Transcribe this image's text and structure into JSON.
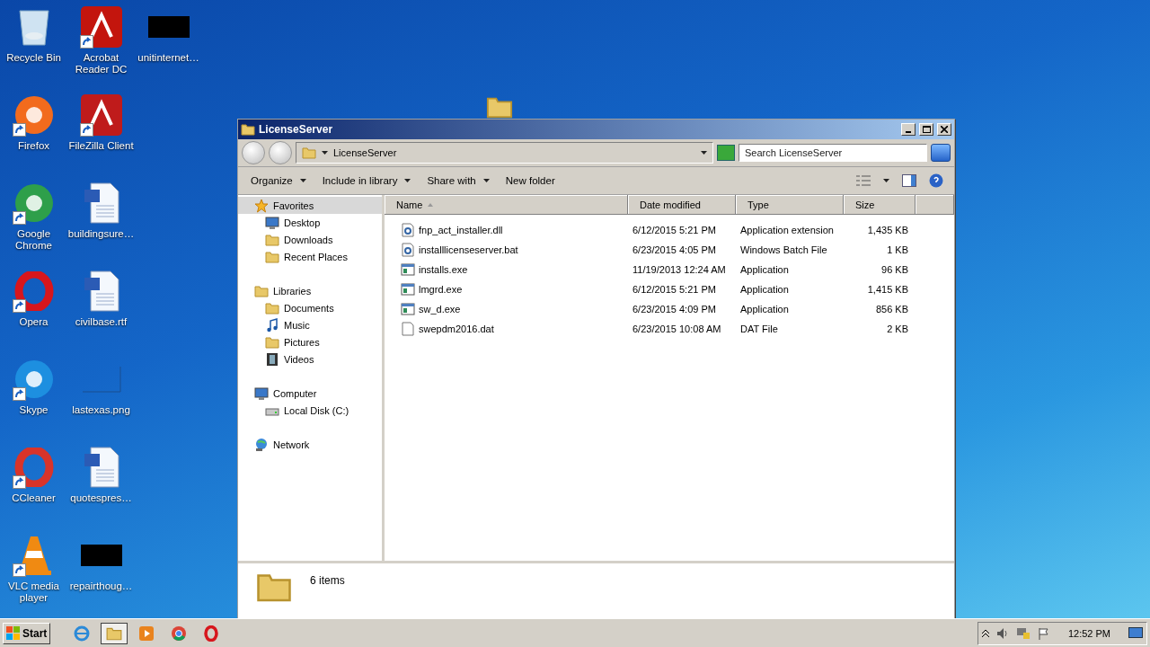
{
  "desktop_icons": [
    {
      "label": "Recycle Bin",
      "kind": "recycle",
      "shortcut": false
    },
    {
      "label": "Firefox",
      "kind": "round",
      "color": "#f26b1d",
      "shortcut": true
    },
    {
      "label": "Google Chrome",
      "kind": "round",
      "color": "#2e9f4a",
      "shortcut": true
    },
    {
      "label": "Opera",
      "kind": "ring",
      "color": "#d7161d",
      "shortcut": true
    },
    {
      "label": "Skype",
      "kind": "round",
      "color": "#1d8fe0",
      "shortcut": true
    },
    {
      "label": "CCleaner",
      "kind": "ring",
      "color": "#d8342a",
      "shortcut": true
    },
    {
      "label": "VLC media player",
      "kind": "cone",
      "color": "#f08a12",
      "shortcut": true
    },
    {
      "label": "Acrobat Reader DC",
      "kind": "square",
      "color": "#c3150d",
      "shortcut": true
    },
    {
      "label": "FileZilla Client",
      "kind": "square",
      "color": "#bf1b1b",
      "shortcut": true
    },
    {
      "label": "buildingsure…",
      "kind": "word",
      "shortcut": false
    },
    {
      "label": "civilbase.rtf",
      "kind": "word",
      "shortcut": false
    },
    {
      "label": "lastexas.png",
      "kind": "blank",
      "shortcut": false
    },
    {
      "label": "quotespres…",
      "kind": "word",
      "shortcut": false
    },
    {
      "label": "repairthoug…",
      "kind": "black",
      "shortcut": false
    },
    {
      "label": "unitinternet…",
      "kind": "black",
      "shortcut": false
    }
  ],
  "window": {
    "title": "LicenseServer",
    "address": "LicenseServer",
    "search": {
      "placeholder": "Search LicenseServer"
    },
    "commands": [
      {
        "label": "Organize",
        "dropdown": true
      },
      {
        "label": "Include in library",
        "dropdown": true
      },
      {
        "label": "Share with",
        "dropdown": true
      },
      {
        "label": "New folder",
        "dropdown": false
      }
    ],
    "nav": [
      {
        "label": "Favorites",
        "kind": "star",
        "selected": true,
        "children": [
          {
            "label": "Desktop",
            "kind": "monitor",
            "selected": false
          },
          {
            "label": "Downloads",
            "kind": "folder",
            "selected": false
          },
          {
            "label": "Recent Places",
            "kind": "folder",
            "selected": false
          }
        ]
      },
      {
        "label": "Libraries",
        "kind": "folder",
        "selected": false,
        "children": [
          {
            "label": "Documents",
            "kind": "folder",
            "selected": false
          },
          {
            "label": "Music",
            "kind": "note",
            "selected": false
          },
          {
            "label": "Pictures",
            "kind": "folder",
            "selected": false
          },
          {
            "label": "Videos",
            "kind": "film",
            "selected": false
          }
        ]
      },
      {
        "label": "Computer",
        "kind": "monitor",
        "selected": false,
        "children": [
          {
            "label": "Local Disk (C:)",
            "kind": "disk",
            "selected": false
          }
        ]
      },
      {
        "label": "Network",
        "kind": "globe",
        "selected": false
      }
    ],
    "columns": [
      {
        "label": "Name",
        "sorted": true
      },
      {
        "label": "Date modified",
        "sorted": false
      },
      {
        "label": "Type",
        "sorted": false
      },
      {
        "label": "Size",
        "sorted": false
      }
    ],
    "files": [
      {
        "name": "fnp_act_installer.dll",
        "date": "6/12/2015 5:21 PM",
        "type": "Application extension",
        "size": "1,435 KB",
        "kind": "gear"
      },
      {
        "name": "installlicenseserver.bat",
        "date": "6/23/2015 4:05 PM",
        "type": "Windows Batch File",
        "size": "1 KB",
        "kind": "gear"
      },
      {
        "name": "installs.exe",
        "date": "11/19/2013 12:24 AM",
        "type": "Application",
        "size": "96 KB",
        "kind": "app"
      },
      {
        "name": "lmgrd.exe",
        "date": "6/12/2015 5:21 PM",
        "type": "Application",
        "size": "1,415 KB",
        "kind": "app"
      },
      {
        "name": "sw_d.exe",
        "date": "6/23/2015 4:09 PM",
        "type": "Application",
        "size": "856 KB",
        "kind": "app"
      },
      {
        "name": "swepdm2016.dat",
        "date": "6/23/2015 10:08 AM",
        "type": "DAT File",
        "size": "2 KB",
        "kind": "blank"
      }
    ],
    "status": "6 items"
  },
  "taskbar": {
    "start": "Start",
    "apps": [
      {
        "kind": "ie",
        "selected": false
      },
      {
        "kind": "folder",
        "selected": true
      },
      {
        "kind": "media",
        "selected": false
      },
      {
        "kind": "chrome",
        "selected": false
      },
      {
        "kind": "opera",
        "selected": false
      }
    ],
    "clock": "12:52 PM"
  }
}
